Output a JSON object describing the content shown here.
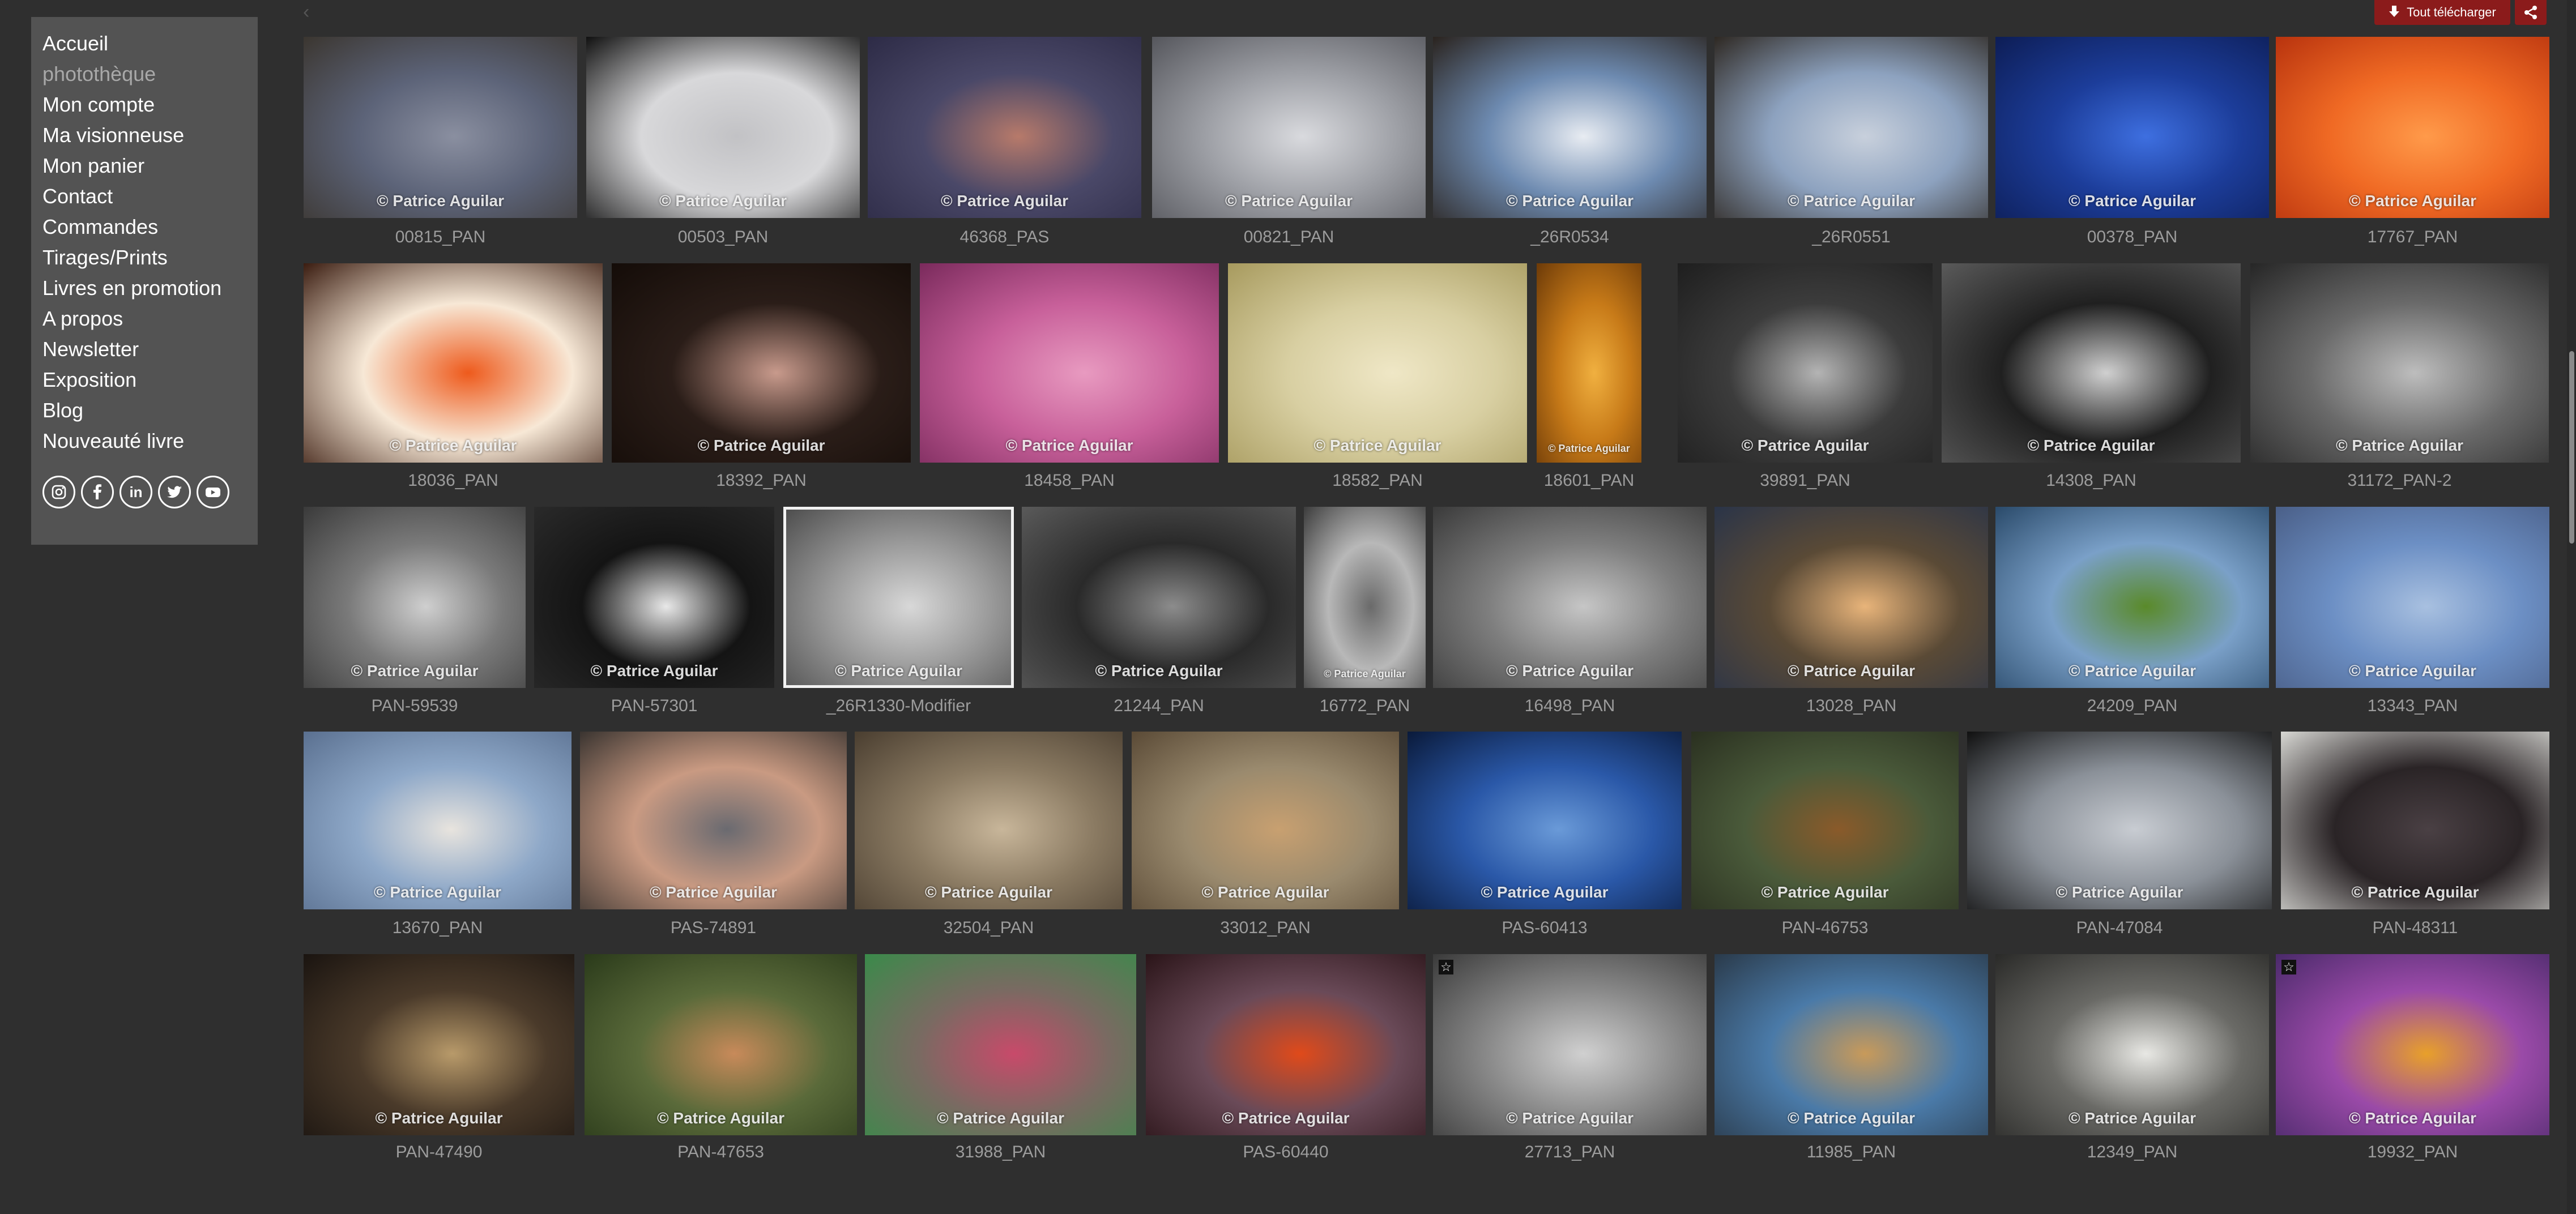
{
  "menu": [
    {
      "label": "Accueil",
      "active": false
    },
    {
      "label": "photothèque",
      "active": true
    },
    {
      "label": "Mon compte",
      "active": false
    },
    {
      "label": "Ma visionneuse",
      "active": false
    },
    {
      "label": "Mon panier",
      "active": false
    },
    {
      "label": "Contact",
      "active": false
    },
    {
      "label": "Commandes",
      "active": false
    },
    {
      "label": "Tirages/Prints",
      "active": false
    },
    {
      "label": "Livres en promotion",
      "active": false
    },
    {
      "label": "A propos",
      "active": false
    },
    {
      "label": "Newsletter",
      "active": false
    },
    {
      "label": "Exposition",
      "active": false
    },
    {
      "label": "Blog",
      "active": false
    },
    {
      "label": "Nouveauté livre",
      "active": false
    }
  ],
  "social": [
    {
      "name": "instagram-icon"
    },
    {
      "name": "facebook-icon"
    },
    {
      "name": "linkedin-icon",
      "text": "in"
    },
    {
      "name": "twitter-icon"
    },
    {
      "name": "youtube-icon"
    }
  ],
  "toolbar": {
    "download_label": "Tout télécharger"
  },
  "watermark": "© Patrice Aguilar",
  "rows": [
    {
      "photos": [
        {
          "caption": "00815_PAN",
          "colors": [
            "#5c6378",
            "#8a8fa0",
            "#3b3630"
          ]
        },
        {
          "caption": "00503_PAN",
          "colors": [
            "#d8d8da",
            "#c2c2c5",
            "#101010"
          ]
        },
        {
          "caption": "46368_PAS",
          "colors": [
            "#4a4868",
            "#b77a6a",
            "#2d2b46"
          ]
        },
        {
          "caption": "00821_PAN",
          "colors": [
            "#9ea0a6",
            "#d9dade",
            "#55565c"
          ]
        },
        {
          "caption": "_26R0534",
          "colors": [
            "#6d8ab0",
            "#e8ecf2",
            "#2a231e"
          ]
        },
        {
          "caption": "_26R0551",
          "colors": [
            "#8da2bf",
            "#c8d0dc",
            "#2e2822"
          ]
        },
        {
          "caption": "00378_PAN",
          "colors": [
            "#1c3d9a",
            "#3e6fe0",
            "#0d1d55"
          ]
        },
        {
          "caption": "17767_PAN",
          "colors": [
            "#f06a24",
            "#ff9a4a",
            "#b8330e"
          ]
        }
      ]
    },
    {
      "photos": [
        {
          "caption": "18036_PAN",
          "colors": [
            "#f7e8d6",
            "#ee5a1c",
            "#3a1c10"
          ]
        },
        {
          "caption": "18392_PAN",
          "colors": [
            "#2a1d18",
            "#c89a8c",
            "#140c08"
          ]
        },
        {
          "caption": "18458_PAN",
          "colors": [
            "#c8609a",
            "#e89ac0",
            "#7a2a5c"
          ]
        },
        {
          "caption": "18582_PAN",
          "colors": [
            "#d8cfa2",
            "#efe7c6",
            "#a79a5e"
          ]
        },
        {
          "caption": "18601_PAN",
          "colors": [
            "#c77a18",
            "#f0b040",
            "#6c3a08"
          ]
        },
        {
          "caption": "39891_PAN",
          "colors": [
            "#3c3c3c",
            "#b4b4b4",
            "#1e1e1e"
          ]
        },
        {
          "caption": "14308_PAN",
          "colors": [
            "#202020",
            "#d0d0d0",
            "#5a5a5a"
          ]
        },
        {
          "caption": "31172_PAN-2",
          "colors": [
            "#6a6a6a",
            "#bdbdbd",
            "#262626"
          ]
        }
      ]
    },
    {
      "photos": [
        {
          "caption": "PAN-59539",
          "colors": [
            "#7a7a7a",
            "#cfcfcf",
            "#3a3a3a"
          ]
        },
        {
          "caption": "PAN-57301",
          "colors": [
            "#141414",
            "#e8e8e8",
            "#2a2a2a"
          ]
        },
        {
          "caption": "_26R1330-Modifier",
          "colors": [
            "#9a9a9a",
            "#d8d8d8",
            "#4a4a4a"
          ],
          "selected": true
        },
        {
          "caption": "21244_PAN",
          "colors": [
            "#2a2a2a",
            "#8c8c8c",
            "#5a5a5a"
          ]
        },
        {
          "caption": "16772_PAN",
          "colors": [
            "#b8b8b8",
            "#6a6a6a",
            "#3c3c3c"
          ]
        },
        {
          "caption": "16498_PAN",
          "colors": [
            "#7e7e7e",
            "#c6c6c6",
            "#3a3a3a"
          ]
        },
        {
          "caption": "13028_PAN",
          "colors": [
            "#5a4a36",
            "#e8b47a",
            "#2a3448"
          ]
        },
        {
          "caption": "24209_PAN",
          "colors": [
            "#7aa0c8",
            "#5a8a2a",
            "#2a4a6a"
          ]
        },
        {
          "caption": "13343_PAN",
          "colors": [
            "#6c8fc4",
            "#a8c0e0",
            "#4a5f88"
          ]
        }
      ]
    },
    {
      "photos": [
        {
          "caption": "13670_PAN",
          "colors": [
            "#8ea8c8",
            "#e8e4de",
            "#5a7090"
          ]
        },
        {
          "caption": "PAS-74891",
          "colors": [
            "#c99a82",
            "#6a6a70",
            "#3a3430"
          ]
        },
        {
          "caption": "32504_PAN",
          "colors": [
            "#8a7a62",
            "#c8b69a",
            "#4a3e30"
          ]
        },
        {
          "caption": "33012_PAN",
          "colors": [
            "#9a8a6e",
            "#c8a070",
            "#5a4a36"
          ]
        },
        {
          "caption": "PAS-60413",
          "colors": [
            "#2a58a8",
            "#6a9ad8",
            "#0a1a3a"
          ]
        },
        {
          "caption": "PAN-46753",
          "colors": [
            "#4a5a3a",
            "#8a5a2a",
            "#2a3020"
          ]
        },
        {
          "caption": "PAN-47084",
          "colors": [
            "#8a9098",
            "#c8ccd2",
            "#101010"
          ]
        },
        {
          "caption": "PAN-48311",
          "colors": [
            "#2a2426",
            "#4a4044",
            "#d8d8d4"
          ]
        }
      ]
    },
    {
      "photos": [
        {
          "caption": "PAN-47490",
          "colors": [
            "#4a3a2a",
            "#b89a6a",
            "#1a1410"
          ]
        },
        {
          "caption": "PAN-47653",
          "colors": [
            "#5a6a3a",
            "#c88a5a",
            "#2a3a1a"
          ]
        },
        {
          "caption": "31988_PAN",
          "colors": [
            "#7a6a62",
            "#c84a6a",
            "#3a8a4a"
          ]
        },
        {
          "caption": "PAS-60440",
          "colors": [
            "#6a4a58",
            "#e04a1a",
            "#2a1418"
          ]
        },
        {
          "caption": "27713_PAN",
          "colors": [
            "#8a8a8a",
            "#d0d0d0",
            "#3a3a3a"
          ],
          "star": true
        },
        {
          "caption": "11985_PAN",
          "colors": [
            "#4a7aa8",
            "#c89a5a",
            "#2a3a4a"
          ]
        },
        {
          "caption": "12349_PAN",
          "colors": [
            "#6a6a66",
            "#e8e8e4",
            "#2a2a28"
          ]
        },
        {
          "caption": "19932_PAN",
          "colors": [
            "#9a4aa8",
            "#e8a02a",
            "#4a2a6a"
          ],
          "star": true
        }
      ]
    }
  ]
}
